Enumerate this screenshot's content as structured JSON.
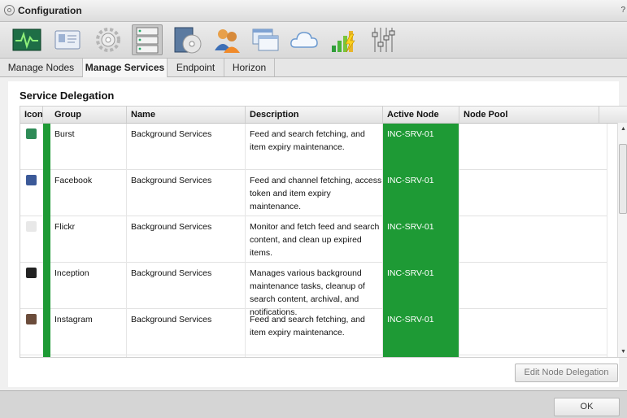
{
  "window": {
    "title": "Configuration",
    "help": "?"
  },
  "toolbar": {
    "items": [
      {
        "name": "dashboard-icon"
      },
      {
        "name": "user-card-icon"
      },
      {
        "name": "gear-icon"
      },
      {
        "name": "server-rack-icon",
        "selected": true
      },
      {
        "name": "archive-disc-icon"
      },
      {
        "name": "users-icon"
      },
      {
        "name": "windows-icon"
      },
      {
        "name": "cloud-icon"
      },
      {
        "name": "bar-chart-icon"
      },
      {
        "name": "sliders-icon"
      }
    ]
  },
  "tabs": [
    {
      "label": "Manage Nodes"
    },
    {
      "label": "Manage Services",
      "active": true
    },
    {
      "label": "Endpoint"
    },
    {
      "label": "Horizon"
    }
  ],
  "section": {
    "title": "Service Delegation"
  },
  "columns": {
    "icon": "Icon",
    "group": "Group",
    "name": "Name",
    "description": "Description",
    "active_node": "Active Node",
    "node_pool": "Node Pool"
  },
  "rows": [
    {
      "icon": "burst-icon",
      "color": "#2e8b57",
      "group": "Burst",
      "name": "Background Services",
      "description": "Feed and search fetching, and item expiry maintenance.",
      "active_node": "INC-SRV-01"
    },
    {
      "icon": "facebook-icon",
      "color": "#3b5998",
      "group": "Facebook",
      "name": "Background Services",
      "description": "Feed and channel fetching, access token and item expiry maintenance.",
      "active_node": "INC-SRV-01"
    },
    {
      "icon": "flickr-icon",
      "color": "#e8e8e8",
      "group": "Flickr",
      "name": "Background Services",
      "description": "Monitor and fetch feed and search content, and clean up expired items.",
      "active_node": "INC-SRV-01"
    },
    {
      "icon": "inception-icon",
      "color": "#222222",
      "group": "Inception",
      "name": "Background Services",
      "description": "Manages various background maintenance tasks, cleanup of search content, archival, and notifications.",
      "active_node": "INC-SRV-01"
    },
    {
      "icon": "instagram-icon",
      "color": "#6b4c3b",
      "group": "Instagram",
      "name": "Background Services",
      "description": "Feed and search fetching, and item expiry maintenance.",
      "active_node": "INC-SRV-01"
    },
    {
      "icon": "app-icon",
      "color": "#333333",
      "group": "",
      "name": "",
      "description": "",
      "active_node": ""
    }
  ],
  "buttons": {
    "edit": "Edit Node Delegation",
    "ok": "OK"
  },
  "colors": {
    "active_node_bg": "#1e9a35"
  }
}
